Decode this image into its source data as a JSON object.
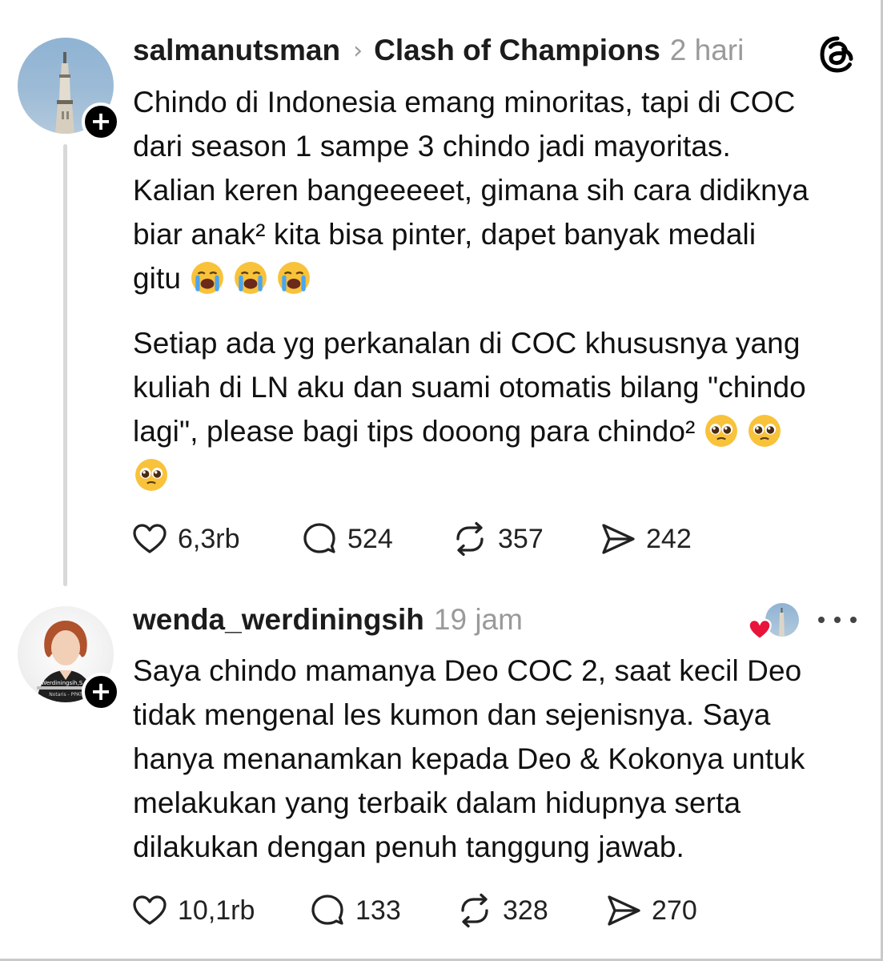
{
  "post": {
    "username": "salmanutsman",
    "community": "Clash of Champions",
    "time": "2 hari",
    "paragraph1": "Chindo di Indonesia emang minoritas, tapi di COC\ndari season 1 sampe 3 chindo jadi mayoritas.\nKalian keren bangeeeeet, gimana sih cara didiknya\nbiar anak² kita bisa pinter, dapet banyak medali\ngitu",
    "paragraph2_l1": "Setiap ada yg perkanalan di COC khususnya yang",
    "paragraph2_l2": "kuliah di LN aku dan suami otomatis bilang \"chindo",
    "paragraph2_l3": "lagi\", please bagi tips dooong para chindo²",
    "paragraph1_emoji": "loudly-crying-face-emoji",
    "paragraph2_emoji": "pleading-face-emoji",
    "likes": "6,3rb",
    "replies": "524",
    "reposts": "357",
    "shares": "242"
  },
  "reply": {
    "username": "wenda_werdiningsih",
    "time": "19 jam",
    "text": "Saya chindo mamanya Deo COC 2, saat kecil Deo\ntidak mengenal les kumon dan sejenisnya. Saya\nhanya menanamkan kepada Deo & Kokonya untuk\nmelakukan yang terbaik dalam hidupnya serta\ndilakukan dengan penuh tanggung jawab.",
    "avatar_caption": "Werdiningsih,S.H.",
    "avatar_caption2": "Notaris - PPAT",
    "likes": "10,1rb",
    "replies": "133",
    "reposts": "328",
    "shares": "270"
  },
  "icons": {
    "chevron": "›",
    "plus": "+"
  },
  "colors": {
    "secondary_text": "#9a9a9a",
    "heart_badge": "#e8143c",
    "emoji_face": "#f8c23a"
  }
}
